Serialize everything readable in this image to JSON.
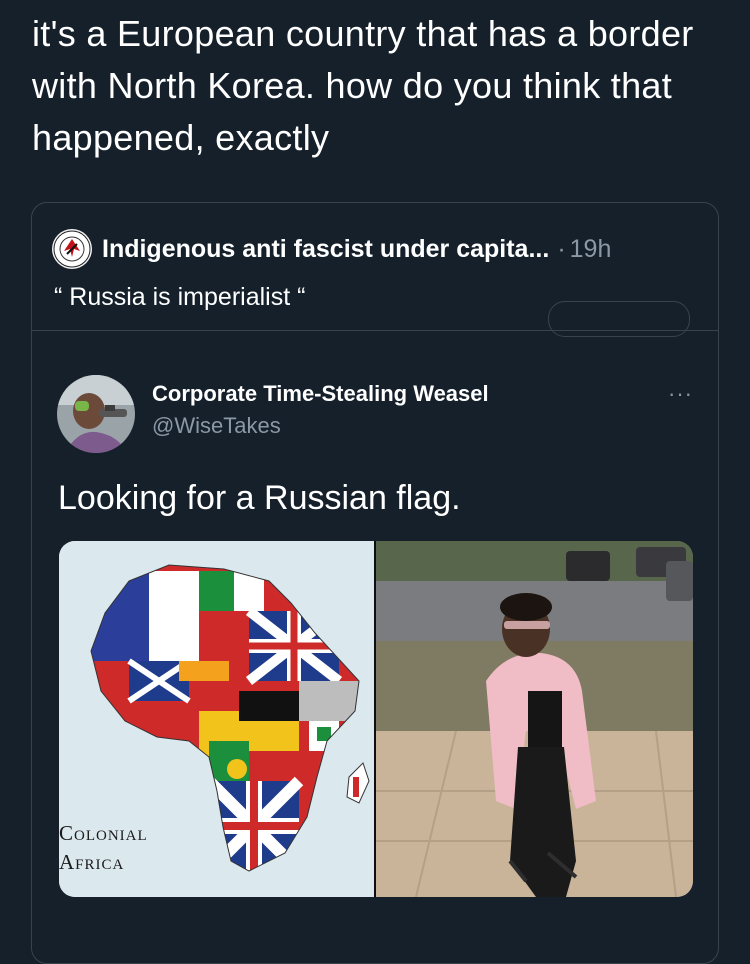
{
  "tweet": {
    "text": "it's a European country that has a border with North Korea. how do you think that happened, exactly"
  },
  "quoted_tweet": {
    "author": "Indigenous anti fascist under capita...",
    "separator": "·",
    "time": "19h",
    "text": "“ Russia is imperialist “"
  },
  "embedded_tweet": {
    "author_name": "Corporate Time-Stealing Weasel",
    "handle": "@WiseTakes",
    "more": "···",
    "text": "Looking for a Russian flag.",
    "media": {
      "map_caption_line1": "Colonial",
      "map_caption_line2": "Africa"
    }
  },
  "icons": {
    "quoted_avatar": "circular-emblem-avatar",
    "embedded_avatar": "user-photo-avatar",
    "more": "more-options-icon"
  }
}
